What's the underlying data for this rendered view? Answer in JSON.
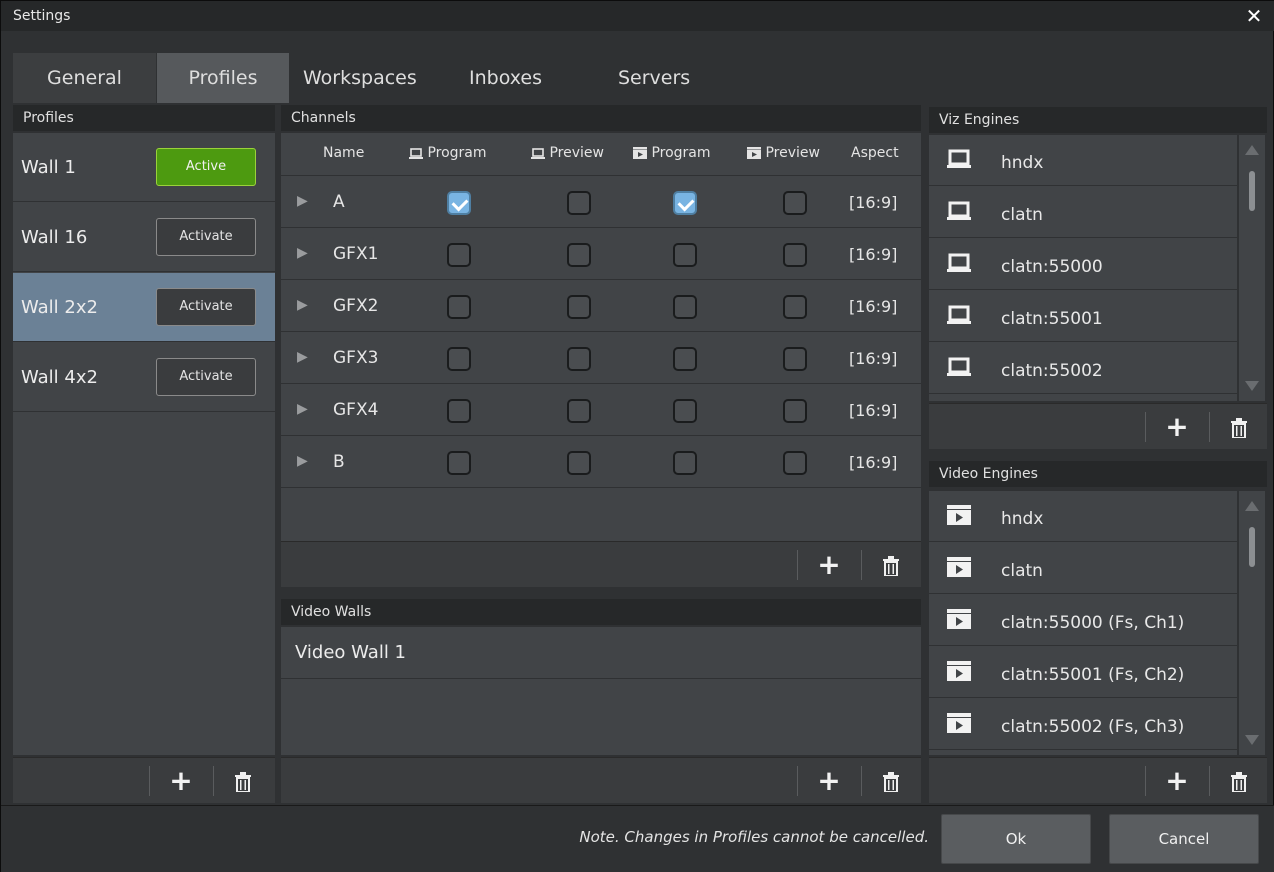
{
  "window": {
    "title": "Settings",
    "close_label": "✕"
  },
  "tabs": [
    {
      "label": "General"
    },
    {
      "label": "Profiles"
    },
    {
      "label": "Workspaces"
    },
    {
      "label": "Inboxes"
    },
    {
      "label": "Servers"
    }
  ],
  "profiles": {
    "header": "Profiles",
    "items": [
      {
        "name": "Wall 1",
        "button": "Active",
        "active": true
      },
      {
        "name": "Wall 16",
        "button": "Activate",
        "active": false
      },
      {
        "name": "Wall 2x2",
        "button": "Activate",
        "active": false,
        "selected": true
      },
      {
        "name": "Wall 4x2",
        "button": "Activate",
        "active": false
      }
    ]
  },
  "channels": {
    "header": "Channels",
    "columns": [
      "Name",
      "Program",
      "Preview",
      "Program",
      "Preview",
      "Aspect"
    ],
    "rows": [
      {
        "name": "A",
        "checks": [
          true,
          false,
          true,
          false
        ],
        "aspect": "[16:9]"
      },
      {
        "name": "GFX1",
        "checks": [
          false,
          false,
          false,
          false
        ],
        "aspect": "[16:9]"
      },
      {
        "name": "GFX2",
        "checks": [
          false,
          false,
          false,
          false
        ],
        "aspect": "[16:9]"
      },
      {
        "name": "GFX3",
        "checks": [
          false,
          false,
          false,
          false
        ],
        "aspect": "[16:9]"
      },
      {
        "name": "GFX4",
        "checks": [
          false,
          false,
          false,
          false
        ],
        "aspect": "[16:9]"
      },
      {
        "name": "B",
        "checks": [
          false,
          false,
          false,
          false
        ],
        "aspect": "[16:9]"
      }
    ]
  },
  "video_walls": {
    "header": "Video Walls",
    "items": [
      "Video Wall 1"
    ]
  },
  "viz_engines": {
    "header": "Viz Engines",
    "icon": "laptop-icon",
    "items": [
      "hndx",
      "clatn",
      "clatn:55000",
      "clatn:55001",
      "clatn:55002"
    ]
  },
  "video_engines": {
    "header": "Video Engines",
    "icon": "clapperboard-icon",
    "items": [
      "hndx",
      "clatn",
      "clatn:55000 (Fs, Ch1)",
      "clatn:55001 (Fs, Ch2)",
      "clatn:55002 (Fs, Ch3)"
    ]
  },
  "footer": {
    "add_label": "+",
    "delete_label": "🗑",
    "note": "Note. Changes in Profiles cannot be cancelled.",
    "ok_label": "Ok",
    "cancel_label": "Cancel"
  },
  "colors": {
    "active_green": "#4d9a10",
    "selected_blue": "#6b8196",
    "checked_blue": "#79b4e2"
  }
}
